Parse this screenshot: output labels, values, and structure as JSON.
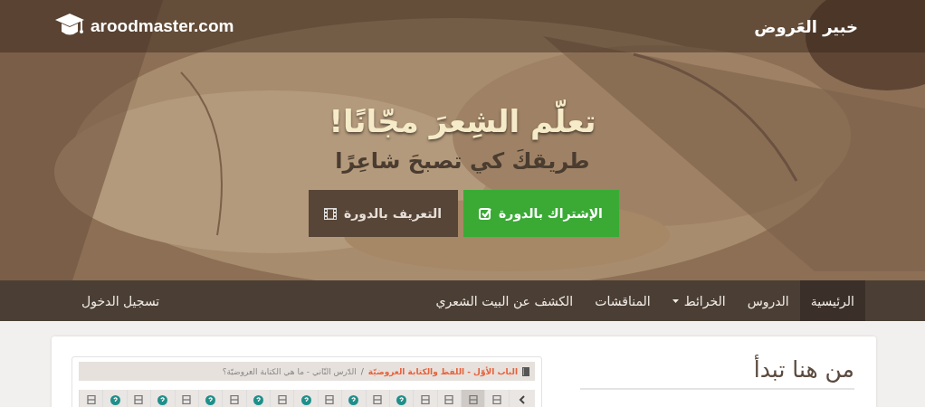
{
  "header": {
    "logo_text": "aroodmaster.com",
    "brand": "خبير العَروض"
  },
  "hero": {
    "kind": "picture",
    "title": "تعلّم الشِعرَ مجّانًا!",
    "subtitle": "طريقكَ كي تصبحَ شاعِرًا",
    "buttons": [
      {
        "label": "الإشتراك بالدورة",
        "kind": "primary"
      },
      {
        "label": "التعريف بالدورة",
        "kind": "secondary"
      }
    ]
  },
  "nav": {
    "items": [
      {
        "label": "الرئيسية",
        "selected": true,
        "dropdown": false
      },
      {
        "label": "الدروس",
        "selected": false,
        "dropdown": false
      },
      {
        "label": "الخرائط",
        "selected": false,
        "dropdown": true
      },
      {
        "label": "المناقشات",
        "selected": false,
        "dropdown": false
      },
      {
        "label": "الكشف عن البيت الشعري",
        "selected": false,
        "dropdown": false
      }
    ],
    "login": "تسجيل الدخول"
  },
  "start": {
    "heading": "من هنا تبدأ"
  },
  "lesson": {
    "breadcrumb": {
      "chapter": "الباب الأوّل - اللفظ والكتابة العروضيّة",
      "separator": "/",
      "current": "الدّرس الثّاني - ما هي الكتابة العروضيّة؟"
    },
    "pager": [
      {
        "kind": "prev",
        "selected": false
      },
      {
        "kind": "page",
        "selected": false
      },
      {
        "kind": "page",
        "selected": true
      },
      {
        "kind": "page",
        "selected": false
      },
      {
        "kind": "page",
        "selected": false
      },
      {
        "kind": "quiz",
        "selected": false
      },
      {
        "kind": "page",
        "selected": false
      },
      {
        "kind": "quiz",
        "selected": false
      },
      {
        "kind": "page",
        "selected": false
      },
      {
        "kind": "quiz",
        "selected": false
      },
      {
        "kind": "page",
        "selected": false
      },
      {
        "kind": "quiz",
        "selected": false
      },
      {
        "kind": "page",
        "selected": false
      },
      {
        "kind": "quiz",
        "selected": false
      },
      {
        "kind": "page",
        "selected": false
      },
      {
        "kind": "quiz",
        "selected": false
      },
      {
        "kind": "page",
        "selected": false
      },
      {
        "kind": "quiz",
        "selected": false
      },
      {
        "kind": "page",
        "selected": false
      }
    ]
  }
}
